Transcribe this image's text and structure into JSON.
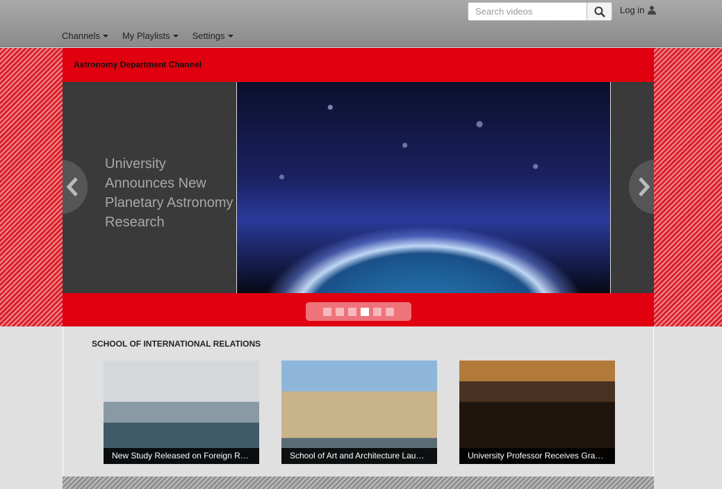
{
  "header": {
    "search_placeholder": "Search videos",
    "login_label": "Log in",
    "nav": [
      "Channels",
      "My Playlists",
      "Settings"
    ]
  },
  "channel": {
    "title": "Astronomy Department Channel",
    "slide_caption": "University Announces New Planetary Astronomy Research",
    "slide_count": 6,
    "active_slide": 4
  },
  "section": {
    "title": "SCHOOL OF INTERNATIONAL RELATIONS",
    "videos": [
      {
        "title": "New Study Released on Foreign Relat…"
      },
      {
        "title": "School of Art and Architecture Launc…"
      },
      {
        "title": "University Professor Receives Grant f…"
      }
    ]
  },
  "colors": {
    "brand_red": "#e0000f"
  }
}
